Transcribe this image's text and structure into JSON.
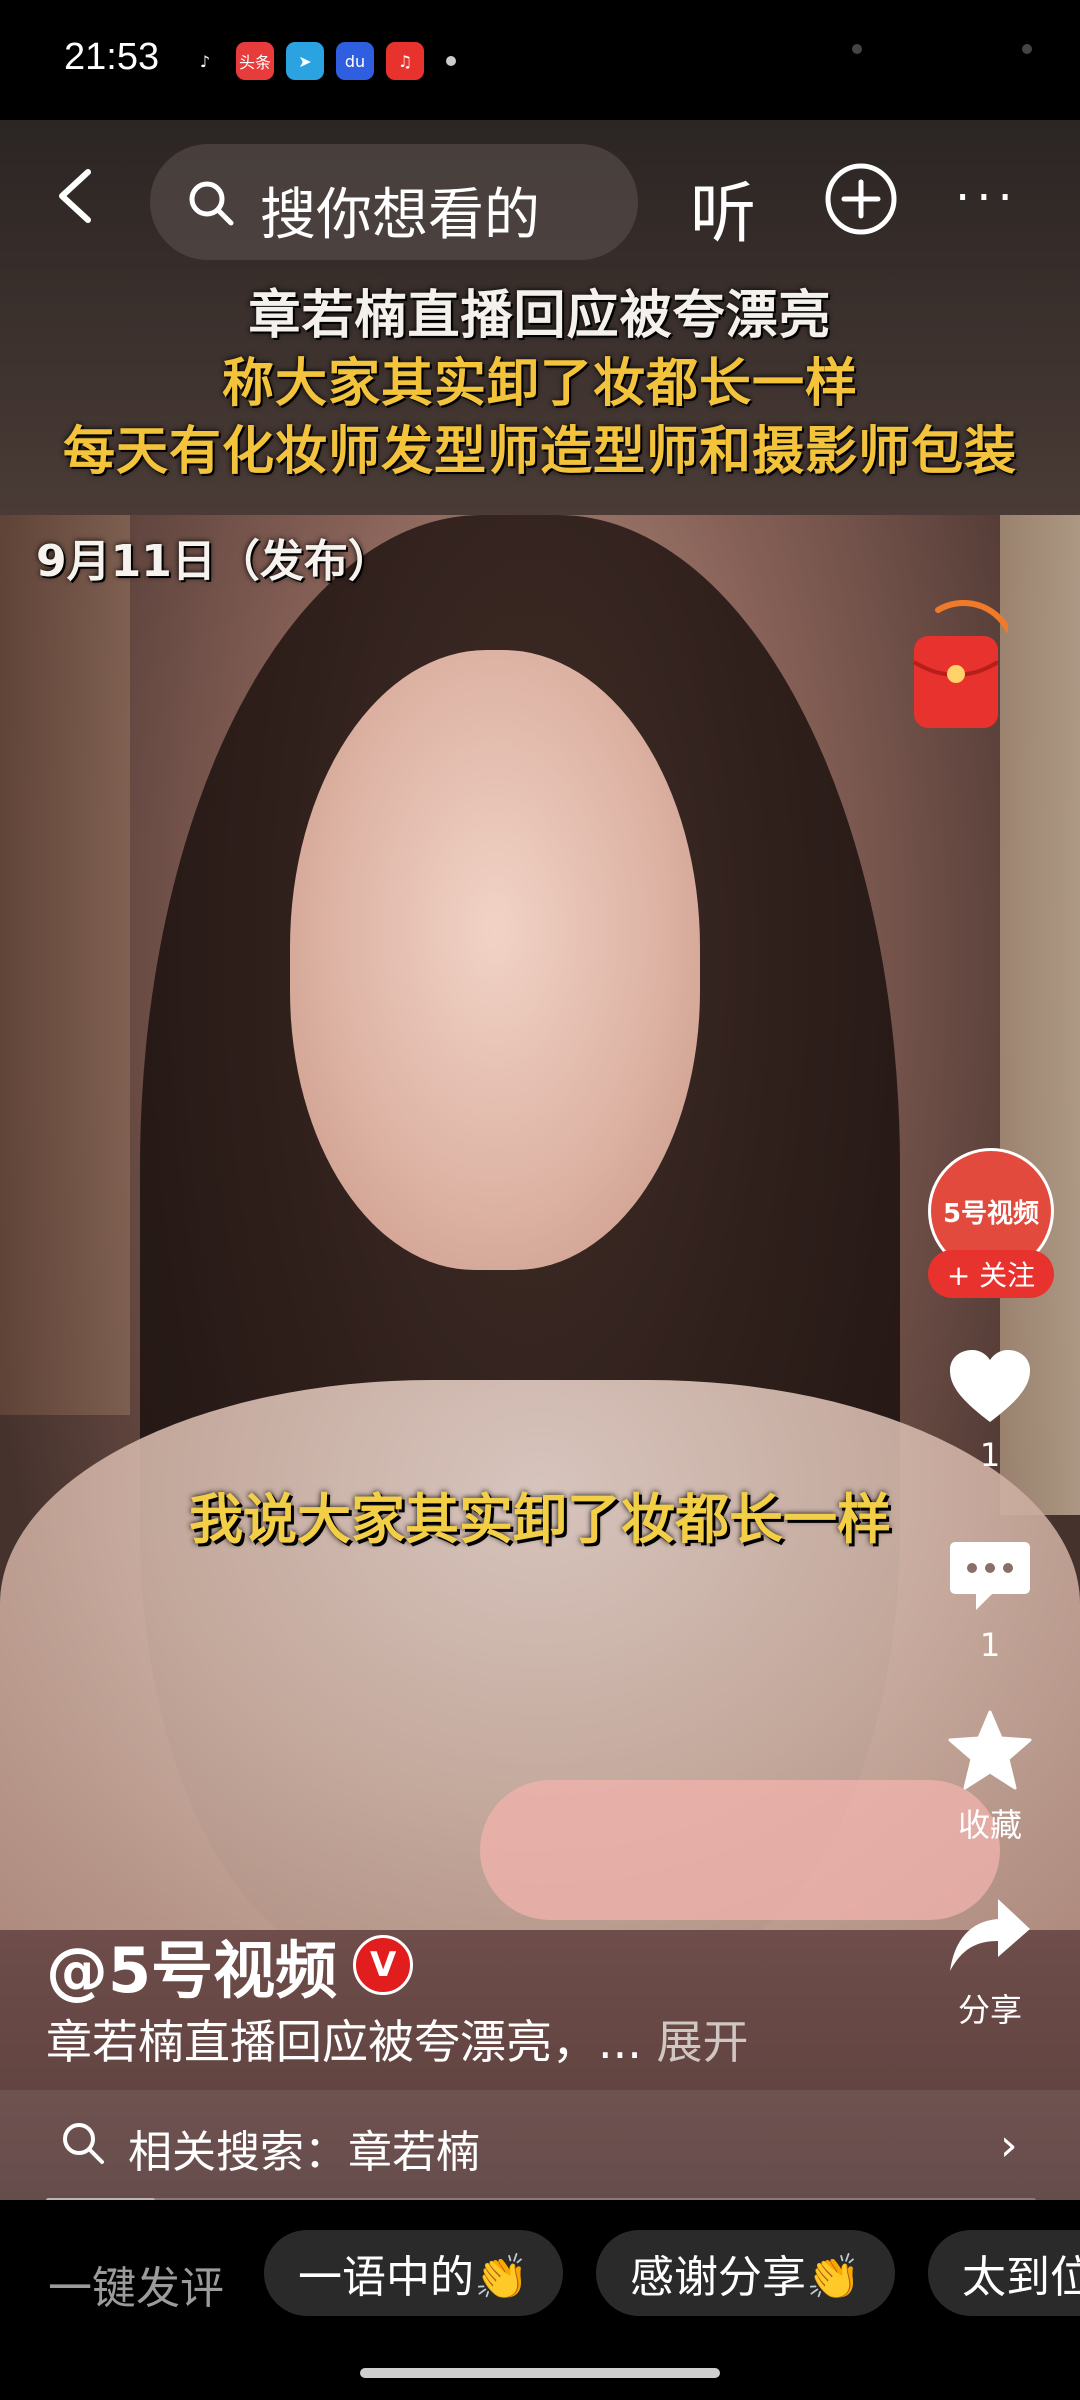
{
  "status_bar": {
    "time": "21:53",
    "apps": [
      {
        "icon": "tiktok-icon",
        "label": "♪",
        "bg": "#000000",
        "fg": "#ffffff"
      },
      {
        "icon": "toutiao-icon",
        "label": "头条",
        "bg": "#e83b3b",
        "fg": "#ffffff"
      },
      {
        "icon": "telegram-icon",
        "label": "➤",
        "bg": "#2aa3e0",
        "fg": "#ffffff"
      },
      {
        "icon": "baidu-icon",
        "label": "du",
        "bg": "#2f5fe0",
        "fg": "#ffffff"
      },
      {
        "icon": "music-icon",
        "label": "♫",
        "bg": "#e8322d",
        "fg": "#ffffff"
      }
    ]
  },
  "nav": {
    "search_placeholder": "搜你想看的",
    "listen_label": "听"
  },
  "video": {
    "headline_line1": "章若楠直播回应被夸漂亮",
    "headline_line2": "称大家其实卸了妆都长一样",
    "headline_line3": "每天有化妆师发型师造型师和摄影师包装",
    "date_label": "9月11日（发布）",
    "subtitle": "我说大家其实卸了妆都长一样"
  },
  "side": {
    "avatar_text": "5号视频",
    "follow_label": "+ 关注",
    "like_count": "1",
    "comment_count": "1",
    "favorite_label": "收藏",
    "share_label": "分享"
  },
  "post": {
    "author": "@5号视频",
    "verified_label": "V",
    "description": "章若楠直播回应被夸漂亮，... ",
    "expand_label": "展开"
  },
  "related": {
    "text": "相关搜索：章若楠",
    "progress": 0.11
  },
  "bottom": {
    "quick_label": "一键发评",
    "chips": [
      "一语中的👏",
      "感谢分享👏",
      "太到位"
    ]
  },
  "colors": {
    "accent_red": "#e8322d",
    "subtitle_yellow": "#f3cf47"
  }
}
